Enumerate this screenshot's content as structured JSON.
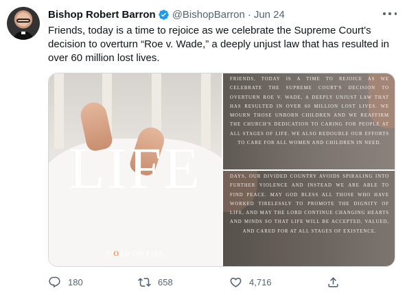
{
  "author": {
    "name": "Bishop Robert Barron",
    "handle": "@BishopBarron",
    "separator": "·",
    "date": "Jun 24"
  },
  "tweet": {
    "text": "Friends, today is a time to rejoice as we celebrate the Supreme Court's decision to overturn “Roe v. Wade,” a deeply unjust law that has resulted in over 60 million lost lives."
  },
  "media": {
    "left_image": {
      "headline": "LIFE",
      "logo_text_pre": "W",
      "logo_text_mark": "O",
      "logo_text_post": "RD ON FIRE"
    },
    "top_right_text": "Friends, today is a time to rejoice as we celebrate the Supreme Court's decision to overturn Roe v. Wade, a deeply unjust law that has resulted in over 60 million lost lives. We mourn those unborn children and we reaffirm the Church's dedication to caring for people at all stages of life. We also redouble our efforts to care for all women and children in need.",
    "bottom_right_text": "Days, our divided country avoids spiraling into further violence and instead we are able to find peace. May God bless all those who have worked tirelessly to promote the dignity of life, and may the Lord continue changing hearts and minds so that life will be accepted, valued, and cared for at all stages of existence."
  },
  "actions": {
    "reply_count": "180",
    "retweet_count": "658",
    "like_count": "4,716"
  },
  "icons": {
    "verified": "verified-badge-icon",
    "more": "more-dots-icon",
    "reply": "reply-icon",
    "retweet": "retweet-icon",
    "like": "heart-icon",
    "share": "share-icon"
  },
  "colors": {
    "verified_blue": "#1d9bf0",
    "text_primary": "#0f1419",
    "text_secondary": "#536471"
  }
}
